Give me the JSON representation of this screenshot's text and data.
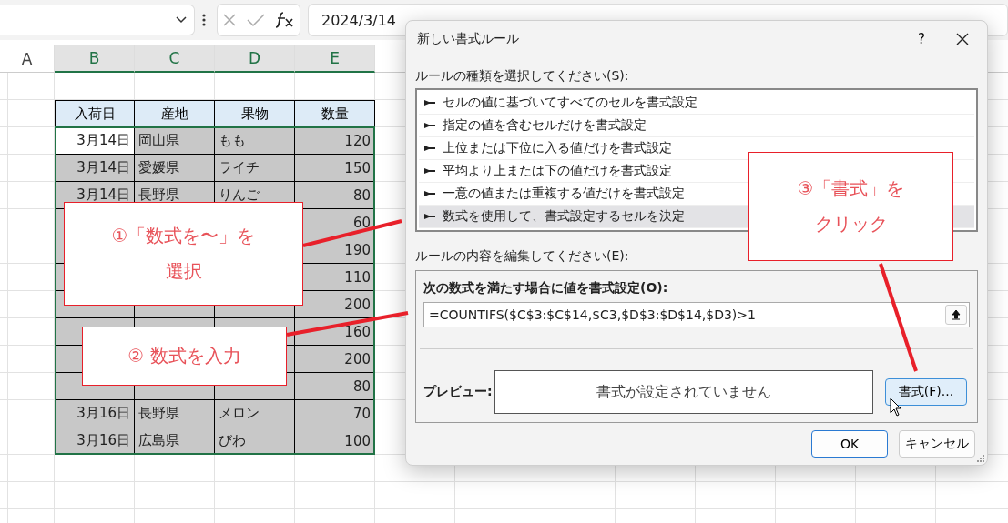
{
  "formula_bar": {
    "formula": "2024/3/14"
  },
  "sheet": {
    "columns": [
      "A",
      "B",
      "C",
      "D",
      "E"
    ],
    "header": [
      "入荷日",
      "産地",
      "果物",
      "数量"
    ],
    "rows": [
      {
        "active": true,
        "date": "3月14日",
        "origin": "岡山県",
        "fruit": "もも",
        "qty": "120"
      },
      {
        "active": false,
        "date": "3月14日",
        "origin": "愛媛県",
        "fruit": "ライチ",
        "qty": "150"
      },
      {
        "active": false,
        "date": "3月14日",
        "origin": "長野県",
        "fruit": "りんご",
        "qty": "80"
      },
      {
        "active": false,
        "qty": "60"
      },
      {
        "active": false,
        "qty": "190"
      },
      {
        "active": false,
        "qty": "110"
      },
      {
        "active": false,
        "qty": "200"
      },
      {
        "active": false,
        "qty": "160"
      },
      {
        "active": false,
        "qty": "200"
      },
      {
        "active": false,
        "qty": "80"
      },
      {
        "active": false,
        "date": "3月16日",
        "origin": "長野県",
        "fruit": "メロン",
        "qty": "70"
      },
      {
        "active": false,
        "date": "3月16日",
        "origin": "広島県",
        "fruit": "びわ",
        "qty": "100"
      }
    ]
  },
  "dialog": {
    "title": "新しい書式ルール",
    "help": "?",
    "type_label": "ルールの種類を選択してください(S):",
    "rule_types": [
      {
        "label": "セルの値に基づいてすべてのセルを書式設定",
        "selected": false
      },
      {
        "label": "指定の値を含むセルだけを書式設定",
        "selected": false
      },
      {
        "label": "上位または下位に入る値だけを書式設定",
        "selected": false
      },
      {
        "label": "平均より上または下の値だけを書式設定",
        "selected": false
      },
      {
        "label": "一意の値または重複する値だけを書式設定",
        "selected": false
      },
      {
        "label": "数式を使用して、書式設定するセルを決定",
        "selected": true
      }
    ],
    "edit_label": "ルールの内容を編集してください(E):",
    "formula_label": "次の数式を満たす場合に値を書式設定(O):",
    "formula": "=COUNTIFS($C$3:$C$14,$C3,$D$3:$D$14,$D3)>1",
    "preview_label": "プレビュー:",
    "preview_text": "書式が設定されていません",
    "format_button": "書式(F)...",
    "ok_button": "OK",
    "cancel_button": "キャンセル"
  },
  "callouts": [
    {
      "lines": [
        "①「数式を〜」を",
        "選択"
      ]
    },
    {
      "lines": [
        "② 数式を入力"
      ]
    },
    {
      "lines": [
        "③「書式」を",
        "クリック"
      ]
    }
  ]
}
